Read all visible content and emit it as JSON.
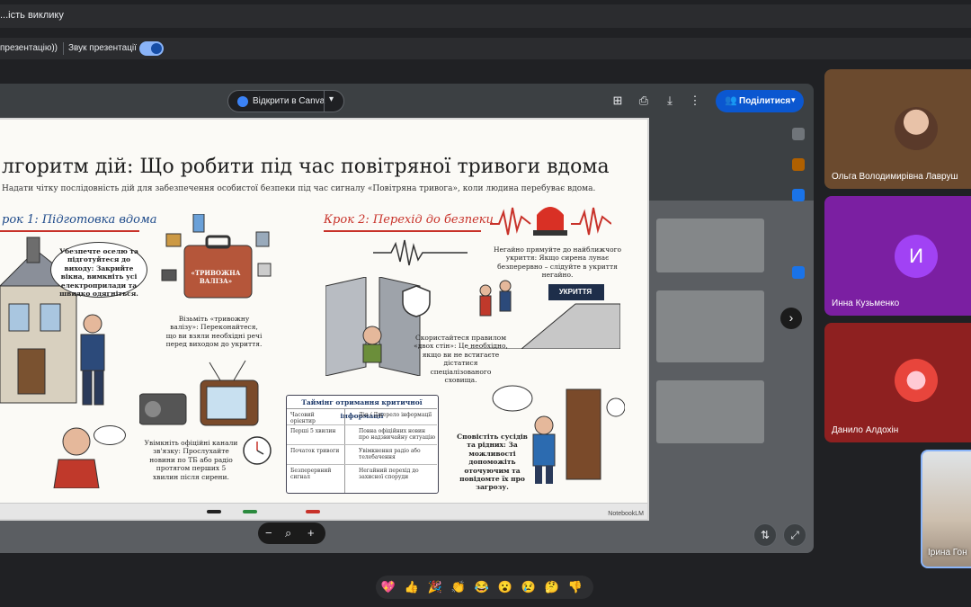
{
  "window": {
    "title": "...ість виклику"
  },
  "sound_bar": {
    "presentation_label": "презентацію))",
    "sound_label": "Звук презентації",
    "toggle_on": true
  },
  "toolbar": {
    "canva_label": "Відкрити в Canva",
    "share_label": "Поділитися",
    "icons": [
      "add-comment-icon",
      "print-icon",
      "download-icon",
      "more-vert-icon"
    ]
  },
  "slide": {
    "title": "лгоритм дій: Що робити під час повітряної тривоги вдома",
    "subtitle": "Надати чітку послідовність дій для забезпечення особистої безпеки під час сигналу «Повітряна тривога», коли людина перебуває вдома.",
    "step1": "рок 1: Підготовка вдома",
    "step2": "Крок 2: Перехід до безпеки",
    "bubble_close": "Убезпечте оселю та підготуйтеся до виходу: Закрийте вікна, вимкніть усі електроприлади та швидко одягніться.",
    "suitcase_label": "«ТРИВОЖНА ВАЛІЗА»",
    "suitcase_text": "Візьміть «тривожну валізу»: Переконайтеся, що ви взяли необхідні речі перед виходом до укриття.",
    "radio_text": "Увімкніть офіційні канали зв'язку: Прослухайте новини по ТБ або радіо протягом перших 5 хвилин після сирени.",
    "shelter_run_text": "Негайно прямуйте до найближчого укриття: Якщо сирена лунає безперервно – слідуйте в укриття негайно.",
    "shelter_sign": "УКРИТТЯ",
    "two_walls_text": "Скористайтеся правилом «двох стін»: Це необхідно, якщо ви не встигаєте дістатися спеціалізованого сховища.",
    "neighbors_text": "Сповістіть сусідів та рідних: За можливості допоможіть оточуючим та повідомте їх про загрозу.",
    "table": {
      "title": "Таймінг отримання критичної інформації",
      "headers": [
        "Часовий орієнтир",
        "Дія / Джерело інформації"
      ],
      "rows": [
        [
          "Перші 5 хвилин",
          "Повна офіційних новин про надзвичайну ситуацію"
        ],
        [
          "Початок тривоги",
          "Увімкнення радіо або телебачення"
        ],
        [
          "Безперервний сигнал",
          "Негайний перехід до захисної споруди"
        ]
      ]
    },
    "brand": "NotebookLM"
  },
  "participants": [
    {
      "name": "Ольга Володимирівна Лавруш",
      "bg": "#6b4a2e",
      "avatar": "photo"
    },
    {
      "name": "Инна Кузьменко",
      "bg": "#7b1fa2",
      "avatar": "И"
    },
    {
      "name": "Данило Алдохін",
      "bg": "#8e2020",
      "avatar": "icon"
    }
  ],
  "self": {
    "name": "Ірина Гон"
  },
  "reactions": [
    "💖",
    "👍",
    "🎉",
    "👏",
    "😂",
    "😮",
    "😢",
    "🤔",
    "👎"
  ]
}
